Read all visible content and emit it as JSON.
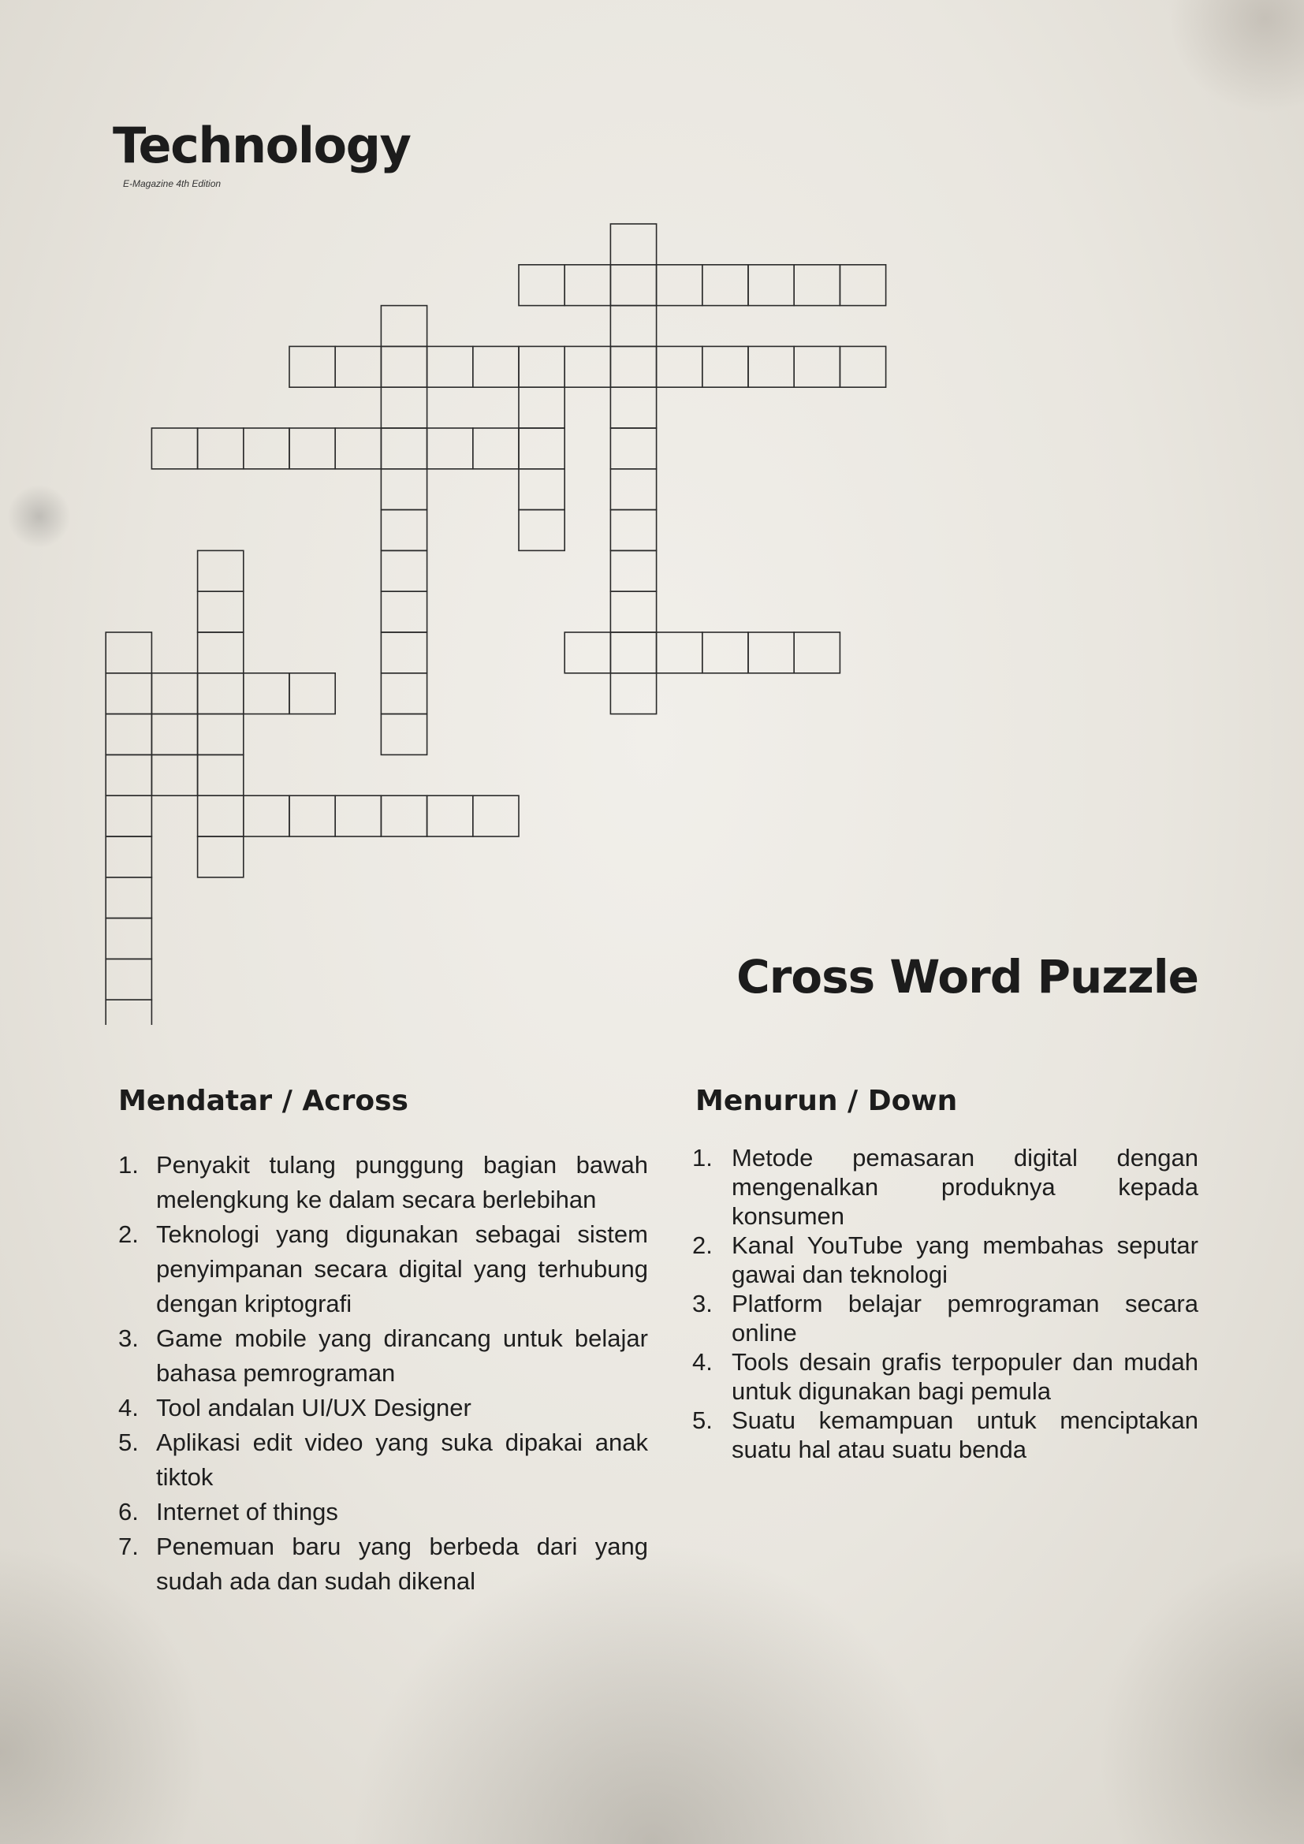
{
  "header": {
    "title": "Technology",
    "subtitle": "E-Magazine 4th Edition"
  },
  "puzzle": {
    "title": "Cross Word Puzzle"
  },
  "across": {
    "heading": "Mendatar / Across",
    "clues": [
      {
        "num": "1.",
        "text": "Penyakit tulang punggung bagian bawah melengkung ke dalam secara berlebihan"
      },
      {
        "num": "2.",
        "text": "Teknologi yang digunakan sebagai sistem penyimpanan secara digital yang terhubung dengan kriptografi"
      },
      {
        "num": "3.",
        "text": "Game mobile yang dirancang untuk belajar bahasa pemrograman"
      },
      {
        "num": "4.",
        "text": "Tool andalan UI/UX Designer"
      },
      {
        "num": "5.",
        "text": " Aplikasi edit video yang suka dipakai anak tiktok"
      },
      {
        "num": "6.",
        "text": "Internet of things"
      },
      {
        "num": "7.",
        "text": "Penemuan baru yang berbeda dari yang sudah ada dan sudah dikenal"
      }
    ]
  },
  "down": {
    "heading": "Menurun / Down",
    "clues": [
      {
        "num": "1.",
        "text": "Metode pemasaran digital dengan mengenalkan produknya kepada konsumen"
      },
      {
        "num": "2.",
        "text": "Kanal YouTube yang membahas seputar gawai dan teknologi"
      },
      {
        "num": "3.",
        "text": "Platform belajar pemrograman secara online"
      },
      {
        "num": "4.",
        "text": "Tools desain grafis terpopuler dan mudah untuk digunakan bagi pemula"
      },
      {
        "num": "5.",
        "text": "Suatu kemampuan untuk menciptakan suatu hal atau suatu benda"
      }
    ]
  }
}
